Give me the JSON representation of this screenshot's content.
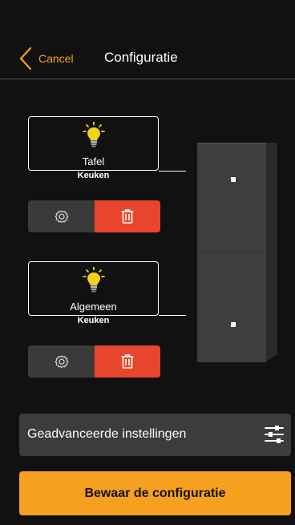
{
  "header": {
    "back_label": "Cancel",
    "title": "Configuratie"
  },
  "cards": [
    {
      "name": "Tafel",
      "room": "Keuken",
      "icon": "lightbulb-icon"
    },
    {
      "name": "Algemeen",
      "room": "Keuken",
      "icon": "lightbulb-icon"
    }
  ],
  "actions": {
    "settings_icon": "gear-icon",
    "delete_icon": "trash-icon"
  },
  "advanced": {
    "label": "Geadvanceerde instellingen",
    "icon": "sliders-icon"
  },
  "save": {
    "label": "Bewaar de configuratie"
  },
  "colors": {
    "accent": "#f6a020",
    "delete": "#e8452e",
    "background": "#111111",
    "panel": "#3c3c3c"
  }
}
